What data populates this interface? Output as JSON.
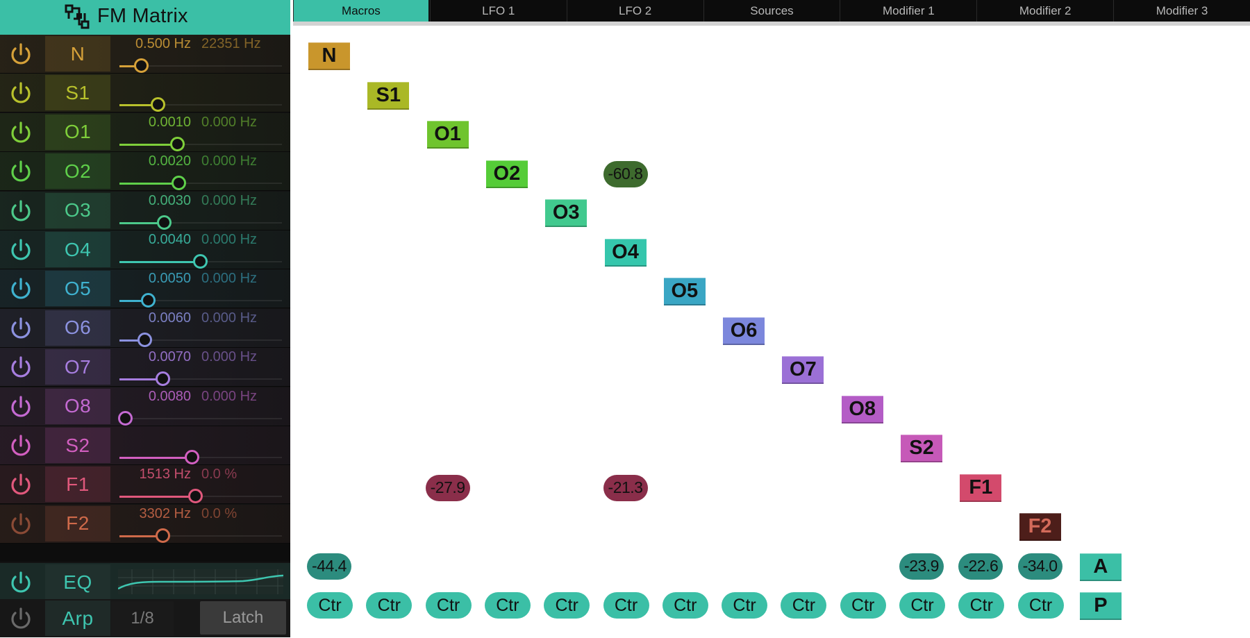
{
  "app": {
    "title": "FM Matrix"
  },
  "tabs": [
    {
      "label": "Macros",
      "active": true
    },
    {
      "label": "LFO 1",
      "active": false
    },
    {
      "label": "LFO 2",
      "active": false
    },
    {
      "label": "Sources",
      "active": false
    },
    {
      "label": "Modifier 1",
      "active": false
    },
    {
      "label": "Modifier 2",
      "active": false
    },
    {
      "label": "Modifier 3",
      "active": false
    }
  ],
  "rows": [
    {
      "label": "N",
      "color": "#d6a139",
      "value1": "0.500 Hz",
      "value2": "22351 Hz",
      "slider": 0.1
    },
    {
      "label": "S1",
      "color": "#b8c12c",
      "value1": "",
      "value2": "",
      "slider": 0.2
    },
    {
      "label": "O1",
      "color": "#7fcf3a",
      "value1": "0.0010",
      "value2": "0.000 Hz",
      "slider": 0.32
    },
    {
      "label": "O2",
      "color": "#5fd04a",
      "value1": "0.0020",
      "value2": "0.000 Hz",
      "slider": 0.33
    },
    {
      "label": "O3",
      "color": "#4cc98a",
      "value1": "0.0030",
      "value2": "0.000 Hz",
      "slider": 0.24
    },
    {
      "label": "O4",
      "color": "#3ec6b0",
      "value1": "0.0040",
      "value2": "0.000 Hz",
      "slider": 0.46
    },
    {
      "label": "O5",
      "color": "#3fb2cf",
      "value1": "0.0050",
      "value2": "0.000 Hz",
      "slider": 0.14
    },
    {
      "label": "O6",
      "color": "#8c92e0",
      "value1": "0.0060",
      "value2": "0.000 Hz",
      "slider": 0.12
    },
    {
      "label": "O7",
      "color": "#a77ee0",
      "value1": "0.0070",
      "value2": "0.000 Hz",
      "slider": 0.23
    },
    {
      "label": "O8",
      "color": "#c46ad2",
      "value1": "0.0080",
      "value2": "0.000 Hz",
      "slider": 0.0
    },
    {
      "label": "S2",
      "color": "#d25fc0",
      "value1": "",
      "value2": "",
      "slider": 0.41
    },
    {
      "label": "F1",
      "color": "#e0587c",
      "value1": "1513 Hz",
      "value2": "0.0 %",
      "slider": 0.43
    },
    {
      "label": "F2",
      "color": "#cf6a4a",
      "value1": "3302 Hz",
      "value2": "0.0 %",
      "slider": 0.23
    }
  ],
  "eq": {
    "label": "EQ",
    "color": "#3ec6b0"
  },
  "arp": {
    "label": "Arp",
    "rate": "1/8",
    "latch": "Latch"
  },
  "matrix": {
    "nodes": [
      {
        "label": "N",
        "color": "#c9962c"
      },
      {
        "label": "S1",
        "color": "#aab826"
      },
      {
        "label": "O1",
        "color": "#6fc42e"
      },
      {
        "label": "O2",
        "color": "#55cc38"
      },
      {
        "label": "O3",
        "color": "#41c98e"
      },
      {
        "label": "O4",
        "color": "#35c6ac"
      },
      {
        "label": "O5",
        "color": "#3aa6c4"
      },
      {
        "label": "O6",
        "color": "#7c87dc"
      },
      {
        "label": "O7",
        "color": "#9b70d6"
      },
      {
        "label": "O8",
        "color": "#b45cc6"
      },
      {
        "label": "S2",
        "color": "#c659b8"
      },
      {
        "label": "F1",
        "color": "#d34a6c"
      },
      {
        "label": "F2",
        "color": "#4d1e1a",
        "text_color": "#d36a5a"
      }
    ],
    "amounts": [
      {
        "value": "-60.8",
        "row": 3,
        "col": 5,
        "color": "#3e6b2e"
      },
      {
        "value": "-27.9",
        "row": 11,
        "col": 2,
        "color": "#8a2e4a"
      },
      {
        "value": "-21.3",
        "row": 11,
        "col": 5,
        "color": "#8a2e4a"
      },
      {
        "value": "-44.4",
        "row": 13,
        "col": 0,
        "color": "#2c8c7e"
      },
      {
        "value": "-23.9",
        "row": 13,
        "col": 10,
        "color": "#2c8c7e"
      },
      {
        "value": "-22.6",
        "row": 13,
        "col": 11,
        "color": "#2c8c7e"
      },
      {
        "value": "-34.0",
        "row": 13,
        "col": 12,
        "color": "#2c8c7e"
      }
    ],
    "outputs": [
      {
        "label": "A",
        "color": "#3bbfa6"
      },
      {
        "label": "P",
        "color": "#3bbfa6"
      }
    ],
    "ctr_label": "Ctr",
    "ctr_count": 13
  }
}
